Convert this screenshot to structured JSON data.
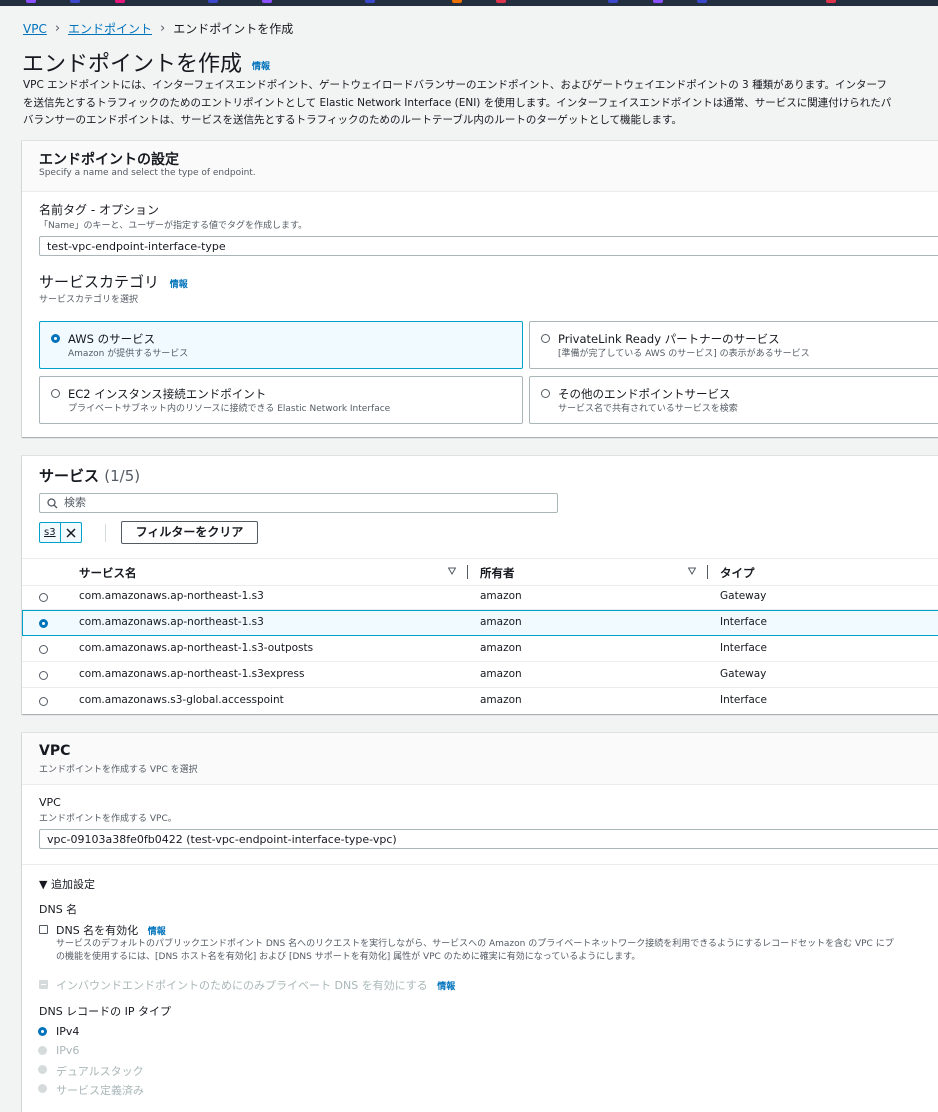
{
  "breadcrumb": {
    "root": "VPC",
    "parent": "エンドポイント",
    "current": "エンドポイントを作成"
  },
  "page": {
    "title": "エンドポイントを作成",
    "info": "情報",
    "description": [
      "VPC エンドポイントには、インターフェイスエンドポイント、ゲートウェイロードバランサーのエンドポイント、およびゲートウェイエンドポイントの 3 種類があります。インターフ",
      "を送信先とするトラフィックのためのエントリポイントとして Elastic Network Interface (ENI) を使用します。インターフェイスエンドポイントは通常、サービスに関連付けられたパ",
      "バランサーのエンドポイントは、サービスを送信先とするトラフィックのためのルートテーブル内のルートのターゲットとして機能します。"
    ]
  },
  "endpoint_settings": {
    "title": "エンドポイントの設定",
    "subtitle": "Specify a name and select the type of endpoint.",
    "name_label": "名前タグ - オプション",
    "name_hint": "「Name」のキーと、ユーザーが指定する値でタグを作成します。",
    "name_value": "test-vpc-endpoint-interface-type",
    "category_label": "サービスカテゴリ",
    "category_info": "情報",
    "category_hint": "サービスカテゴリを選択",
    "categories": [
      {
        "title": "AWS のサービス",
        "sub": "Amazon が提供するサービス",
        "selected": true
      },
      {
        "title": "PrivateLink Ready パートナーのサービス",
        "sub": "[準備が完了している AWS のサービス] の表示があるサービス",
        "selected": false
      },
      {
        "title": "EC2 インスタンス接続エンドポイント",
        "sub": "プライベートサブネット内のリソースに接続できる Elastic Network Interface",
        "selected": false
      },
      {
        "title": "その他のエンドポイントサービス",
        "sub": "サービス名で共有されているサービスを検索",
        "selected": false
      }
    ]
  },
  "services": {
    "title": "サービス",
    "count": "(1/5)",
    "search_placeholder": "検索",
    "filter_token": "s3",
    "clear_button": "フィルターをクリア",
    "columns": [
      "サービス名",
      "所有者",
      "タイプ"
    ],
    "rows": [
      {
        "name": "com.amazonaws.ap-northeast-1.s3",
        "owner": "amazon",
        "type": "Gateway",
        "selected": false
      },
      {
        "name": "com.amazonaws.ap-northeast-1.s3",
        "owner": "amazon",
        "type": "Interface",
        "selected": true
      },
      {
        "name": "com.amazonaws.ap-northeast-1.s3-outposts",
        "owner": "amazon",
        "type": "Interface",
        "selected": false
      },
      {
        "name": "com.amazonaws.ap-northeast-1.s3express",
        "owner": "amazon",
        "type": "Gateway",
        "selected": false
      },
      {
        "name": "com.amazonaws.s3-global.accesspoint",
        "owner": "amazon",
        "type": "Interface",
        "selected": false
      }
    ]
  },
  "vpc": {
    "title": "VPC",
    "subtitle": "エンドポイントを作成する VPC を選択",
    "field_label": "VPC",
    "field_hint": "エンドポイントを作成する VPC。",
    "value": "vpc-09103a38fe0fb0422 (test-vpc-endpoint-interface-type-vpc)",
    "additional": "▼ 追加設定",
    "dns_name_label": "DNS 名",
    "dns_enable": "DNS 名を有効化",
    "dns_info": "情報",
    "dns_desc": [
      "サービスのデフォルトのパブリックエンドポイント DNS 名へのリクエストを実行しながら、サービスへの Amazon のプライベートネットワーク接続を利用できるようにするレコードセットを含む VPC にプ",
      "の機能を使用するには、[DNS ホスト名を有効化] および [DNS サポートを有効化] 属性が VPC のために確実に有効になっているようにします。"
    ],
    "inbound_only": "インバウンドエンドポイントのためにのみプライベート DNS を有効にする",
    "inbound_info": "情報",
    "ip_type_label": "DNS レコードの IP タイプ",
    "ip_options": [
      {
        "label": "IPv4",
        "state": "selected"
      },
      {
        "label": "IPv6",
        "state": "disabled"
      },
      {
        "label": "デュアルスタック",
        "state": "disabled"
      },
      {
        "label": "サービス定義済み",
        "state": "disabled"
      }
    ]
  }
}
